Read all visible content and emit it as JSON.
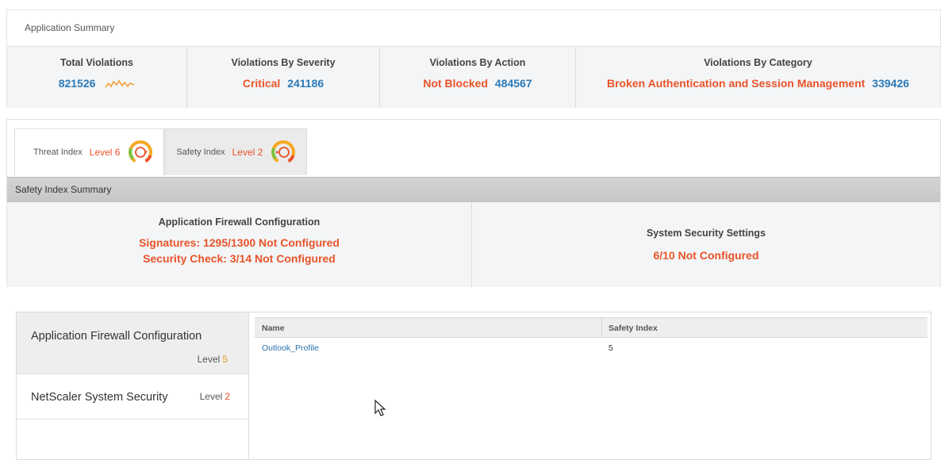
{
  "app_summary": {
    "title": "Application Summary",
    "total_violations": {
      "label": "Total Violations",
      "value": "821526"
    },
    "by_severity": {
      "label": "Violations By Severity",
      "name": "Critical",
      "value": "241186"
    },
    "by_action": {
      "label": "Violations By Action",
      "name": "Not Blocked",
      "value": "484567"
    },
    "by_category": {
      "label": "Violations By Category",
      "name": "Broken Authentication and Session Management",
      "value": "339426"
    }
  },
  "tabs": [
    {
      "label": "Threat Index",
      "level": "Level 6",
      "icon": "gauge-icon"
    },
    {
      "label": "Safety Index",
      "level": "Level 2",
      "icon": "gauge-icon"
    }
  ],
  "safety_summary": {
    "title": "Safety Index Summary",
    "firewall": {
      "heading": "Application Firewall Configuration",
      "line1": "Signatures: 1295/1300 Not Configured",
      "line2": "Security Check: 3/14 Not Configured"
    },
    "system": {
      "heading": "System Security Settings",
      "line1": "6/10 Not Configured"
    }
  },
  "side_list": [
    {
      "name": "Application Firewall Configuration",
      "level_label": "Level",
      "level_value": "5"
    },
    {
      "name": "NetScaler System Security",
      "level_label": "Level",
      "level_value": "2"
    }
  ],
  "table": {
    "columns": [
      "Name",
      "Safety Index"
    ],
    "rows": [
      {
        "name": "Outlook_Profile",
        "safety_index": "5"
      }
    ]
  },
  "colors": {
    "accent_red": "#e8542a",
    "accent_blue": "#2a7ab9",
    "level_orange": "#e89a2a",
    "gauge_green": "#7cc242",
    "gauge_orange": "#f7a823"
  }
}
